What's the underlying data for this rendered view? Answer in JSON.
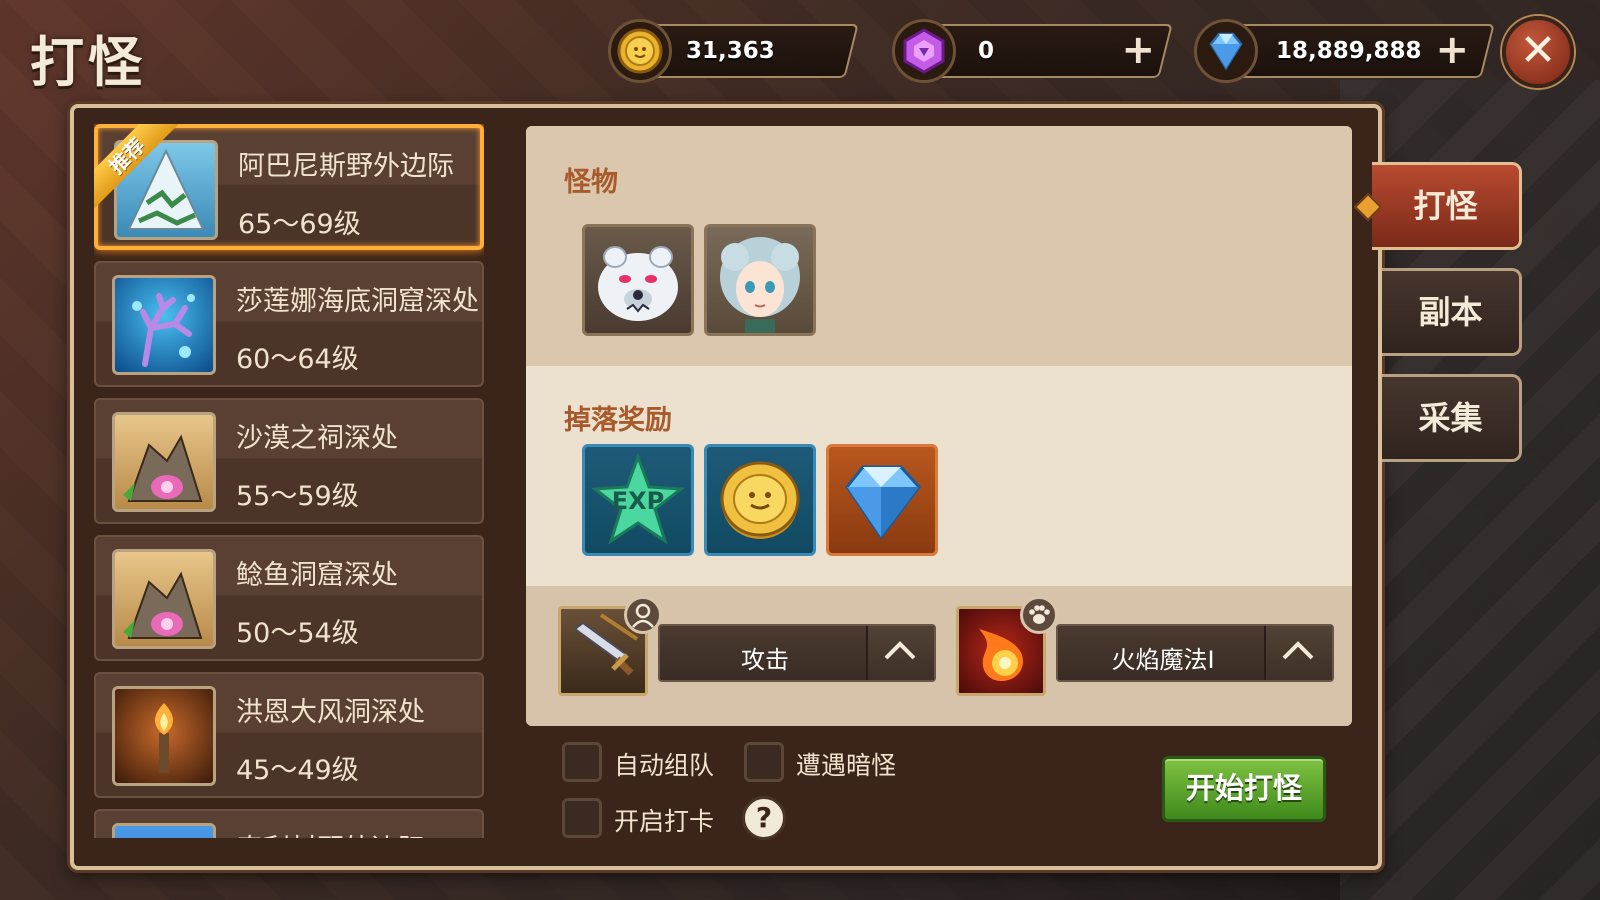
{
  "page": {
    "title": "打怪"
  },
  "currency": {
    "gold": {
      "icon": "gold-coin-icon",
      "value": "31,363"
    },
    "gem": {
      "icon": "purple-gem-icon",
      "value": "0",
      "plus": "+"
    },
    "diamond": {
      "icon": "diamond-icon",
      "value": "18,889,888",
      "plus": "+"
    }
  },
  "close_label": "✕",
  "stages": [
    {
      "name": "阿巴尼斯野外边际",
      "level": "65～69级",
      "recommended": true,
      "badge": "推荐",
      "thumb": "snowy-mountain-icon"
    },
    {
      "name": "莎莲娜海底洞窟深处",
      "level": "60～64级",
      "recommended": false,
      "thumb": "coral-reef-icon"
    },
    {
      "name": "沙漠之祠深处",
      "level": "55～59级",
      "recommended": false,
      "thumb": "rock-shell-icon"
    },
    {
      "name": "鲶鱼洞窟深处",
      "level": "50～54级",
      "recommended": false,
      "thumb": "rock-shell-icon"
    },
    {
      "name": "洪恩大风洞深处",
      "level": "45～49级",
      "recommended": false,
      "thumb": "torch-cave-icon"
    },
    {
      "name": "奇利村野外边际",
      "level": "",
      "recommended": false,
      "thumb": "sky-icon"
    }
  ],
  "monsters": {
    "title": "怪物",
    "items": [
      {
        "icon": "polar-bear-icon"
      },
      {
        "icon": "ice-maiden-icon"
      }
    ]
  },
  "drops": {
    "title": "掉落奖励",
    "items": [
      {
        "icon": "exp-star-icon",
        "text": "EXP"
      },
      {
        "icon": "gold-coin-icon"
      },
      {
        "icon": "diamond-icon"
      }
    ]
  },
  "skills": {
    "attack": {
      "label": "攻击",
      "icon": "sword-icon",
      "badge": "person-icon"
    },
    "pet": {
      "label": "火焰魔法Ⅰ",
      "icon": "fireball-icon",
      "badge": "paw-icon"
    }
  },
  "options": {
    "auto_team": "自动组队",
    "encounter_hidden": "遭遇暗怪",
    "check_in": "开启打卡",
    "help": "?"
  },
  "start_button": "开始打怪",
  "side_tabs": [
    {
      "label": "打怪",
      "active": true
    },
    {
      "label": "副本",
      "active": false
    },
    {
      "label": "采集",
      "active": false
    }
  ],
  "colors": {
    "accent_orange": "#ffb039",
    "panel_bg": "#3b2419",
    "start_green": "#5fa82e",
    "active_tab_red": "#b84a30"
  }
}
